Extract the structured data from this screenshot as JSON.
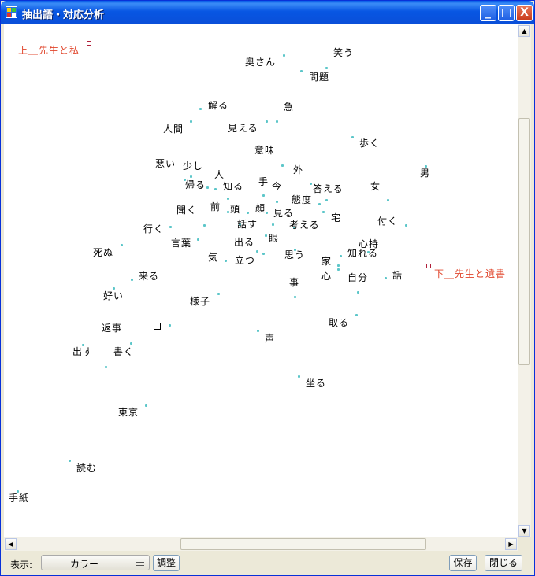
{
  "window": {
    "title": "抽出語・対応分析",
    "minimize": "_",
    "maximize": "□",
    "close": "X"
  },
  "colors": {
    "point": "#5cc6c9",
    "variable_label": "#e0452b",
    "marker": "#b0203a"
  },
  "plot_points": [
    {
      "label": "奥さん"
    },
    {
      "label": "笑う"
    },
    {
      "label": "問題"
    },
    {
      "label": "解る"
    },
    {
      "label": "急"
    },
    {
      "label": "人間"
    },
    {
      "label": "見える"
    },
    {
      "label": "歩く"
    },
    {
      "label": "意味"
    },
    {
      "label": "男"
    },
    {
      "label": "悪い"
    },
    {
      "label": "少し"
    },
    {
      "label": "外"
    },
    {
      "label": "人"
    },
    {
      "label": "帰る"
    },
    {
      "label": "知る"
    },
    {
      "label": "手"
    },
    {
      "label": "今"
    },
    {
      "label": "答える"
    },
    {
      "label": "女"
    },
    {
      "label": "態度"
    },
    {
      "label": "聞く"
    },
    {
      "label": "前"
    },
    {
      "label": "頭"
    },
    {
      "label": "顔"
    },
    {
      "label": "見る"
    },
    {
      "label": "宅"
    },
    {
      "label": "付く"
    },
    {
      "label": "行く"
    },
    {
      "label": "話す"
    },
    {
      "label": "考える"
    },
    {
      "label": "言葉"
    },
    {
      "label": "眼"
    },
    {
      "label": "心持"
    },
    {
      "label": "死ぬ"
    },
    {
      "label": "出る"
    },
    {
      "label": "知れる"
    },
    {
      "label": "気"
    },
    {
      "label": "思う"
    },
    {
      "label": "立つ"
    },
    {
      "label": "家"
    },
    {
      "label": "来る"
    },
    {
      "label": "心"
    },
    {
      "label": "自分"
    },
    {
      "label": "話"
    },
    {
      "label": "事"
    },
    {
      "label": "好い"
    },
    {
      "label": "様子"
    },
    {
      "label": "取る"
    },
    {
      "label": "返事"
    },
    {
      "label": "声"
    },
    {
      "label": "出す"
    },
    {
      "label": "書く"
    },
    {
      "label": "坐る"
    },
    {
      "label": "東京"
    },
    {
      "label": "読む"
    },
    {
      "label": "手紙"
    }
  ],
  "variables": [
    {
      "label": "上＿先生と私"
    },
    {
      "label": "下＿先生と遺書"
    }
  ],
  "controls": {
    "display_label": "表示:",
    "display_value": "カラー",
    "adjust": "調整",
    "save": "保存",
    "close": "閉じる"
  }
}
